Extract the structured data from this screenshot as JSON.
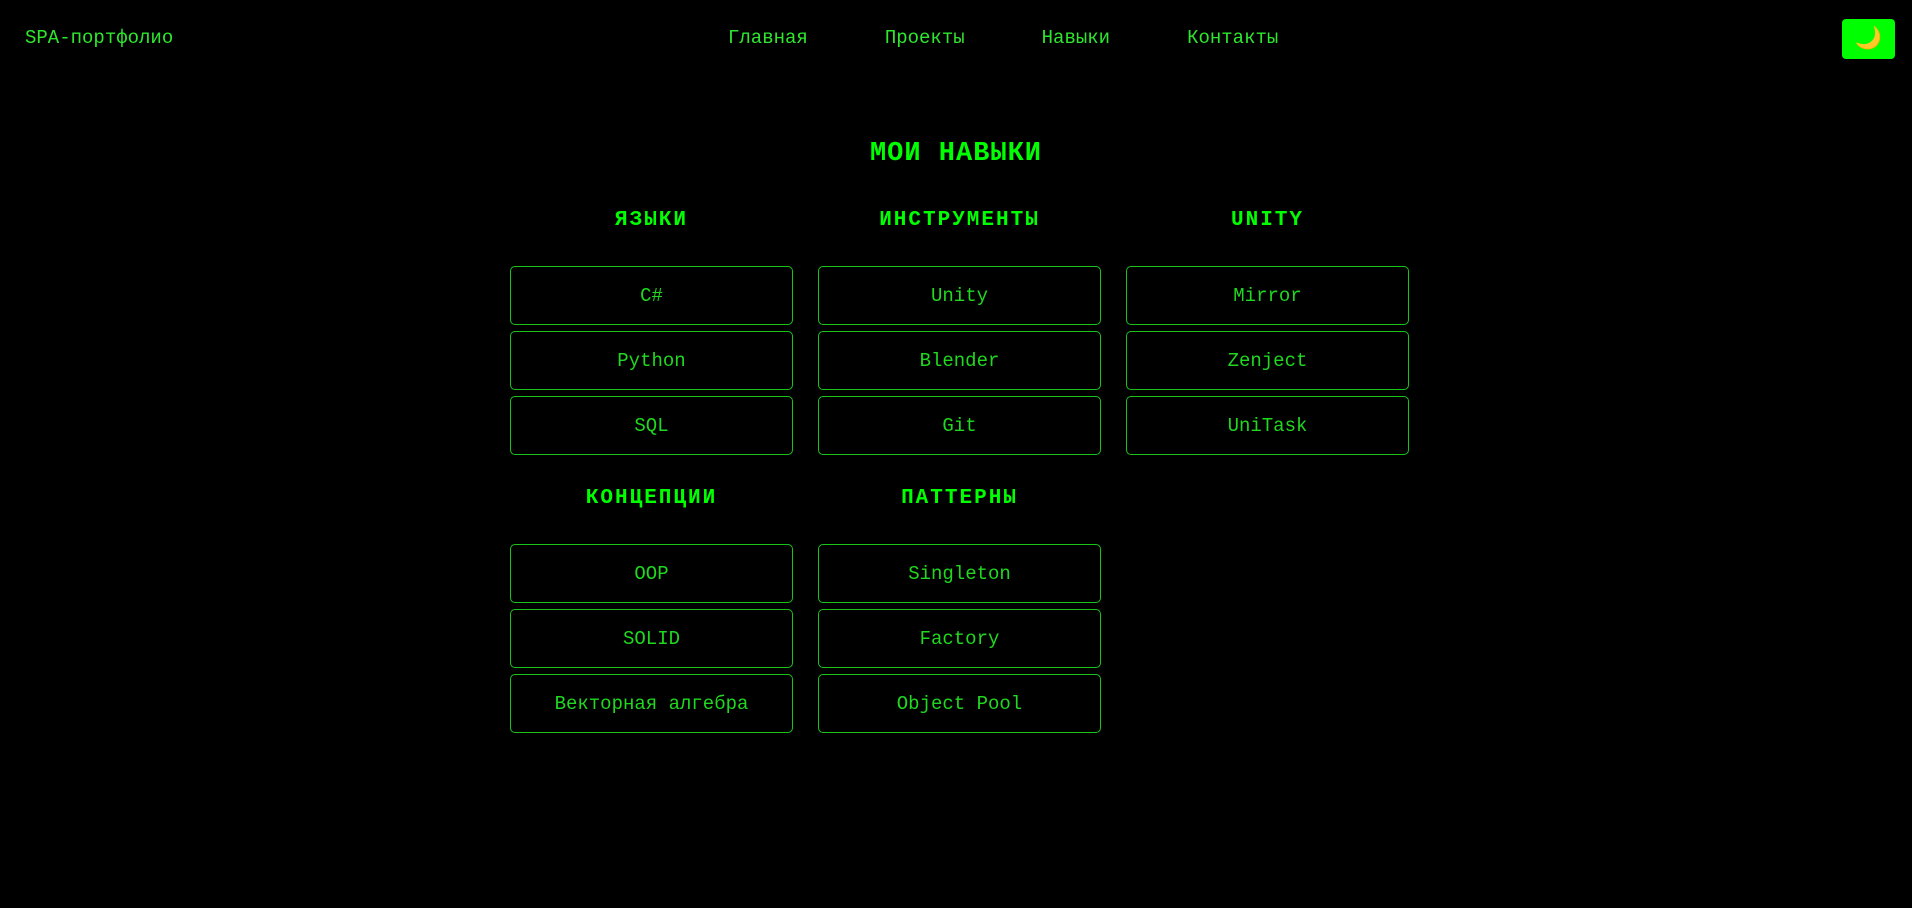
{
  "header": {
    "brand": "SPA-портфолио",
    "nav": [
      {
        "label": "Главная"
      },
      {
        "label": "Проекты"
      },
      {
        "label": "Навыки"
      },
      {
        "label": "Контакты"
      }
    ],
    "theme_toggle": {
      "icon": "moon-icon",
      "glyph": "🌙"
    }
  },
  "main": {
    "title": "МОИ НАВЫКИ",
    "categories": [
      {
        "title": "ЯЗЫКИ",
        "skills": [
          "C#",
          "Python",
          "SQL"
        ]
      },
      {
        "title": "ИНСТРУМЕНТЫ",
        "skills": [
          "Unity",
          "Blender",
          "Git"
        ]
      },
      {
        "title": "UNITY",
        "skills": [
          "Mirror",
          "Zenject",
          "UniTask"
        ]
      },
      {
        "title": "КОНЦЕПЦИИ",
        "skills": [
          "OOP",
          "SOLID",
          "Векторная алгебра"
        ]
      },
      {
        "title": "ПАТТЕРНЫ",
        "skills": [
          "Singleton",
          "Factory",
          "Object Pool"
        ]
      }
    ]
  },
  "colors": {
    "background": "#000000",
    "accent": "#00ff00",
    "text": "#1fd81f"
  }
}
